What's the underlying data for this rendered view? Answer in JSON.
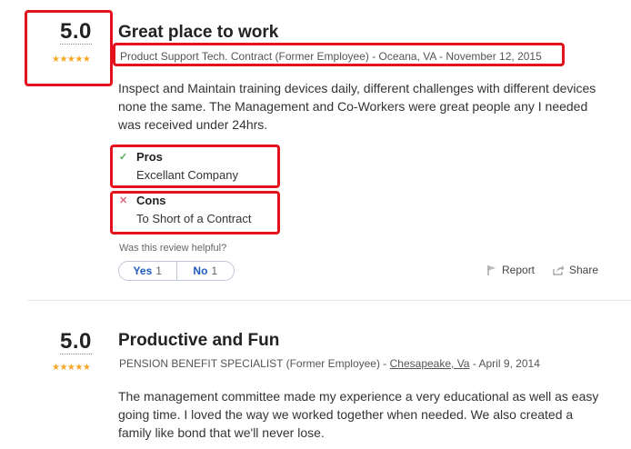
{
  "reviews": [
    {
      "rating": "5.0",
      "stars": "★★★★★",
      "title": "Great place to work",
      "meta": "Product Support Tech. Contract (Former Employee) - Oceana, VA - November 12, 2015",
      "text": "Inspect and Maintain training devices daily, different challenges with different devices none the same. The Management and Co-Workers were great people any I needed was received under 24hrs.",
      "pros_label": "Pros",
      "pros": "Excellant Company",
      "cons_label": "Cons",
      "cons": "To Short of a Contract",
      "helpful_question": "Was this review helpful?",
      "yes_label": "Yes",
      "yes_count": "1",
      "no_label": "No",
      "no_count": "1",
      "report_label": "Report",
      "share_label": "Share"
    },
    {
      "rating": "5.0",
      "stars": "★★★★★",
      "title": "Productive and Fun",
      "meta_prefix": "PENSION BENEFIT SPECIALIST (Former Employee) - ",
      "meta_location": "Chesapeake, Va",
      "meta_suffix": " - April 9, 2014",
      "text": "The management committee made my experience a very educational as well as easy going time. I loved the way we worked together when needed. We also created a family like bond that we'll never lose."
    }
  ],
  "colors": {
    "highlight_border": "#e4121c",
    "star": "#f5a623",
    "link_blue": "#1f5bbd"
  },
  "icons": {
    "pros": "check-icon",
    "cons": "x-icon",
    "report": "flag-icon",
    "share": "share-icon"
  }
}
